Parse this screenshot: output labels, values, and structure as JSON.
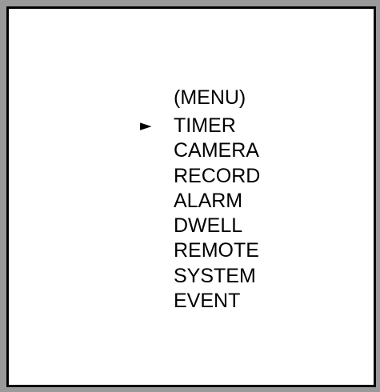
{
  "menu": {
    "title": "(MENU)",
    "cursor_icon": "right-triangle-pointer-icon",
    "cursor_glyph": "►",
    "selected_index": 0,
    "items": [
      {
        "label": "TIMER"
      },
      {
        "label": "CAMERA"
      },
      {
        "label": "RECORD"
      },
      {
        "label": "ALARM"
      },
      {
        "label": "DWELL"
      },
      {
        "label": "REMOTE"
      },
      {
        "label": "SYSTEM"
      },
      {
        "label": "EVENT"
      }
    ]
  }
}
